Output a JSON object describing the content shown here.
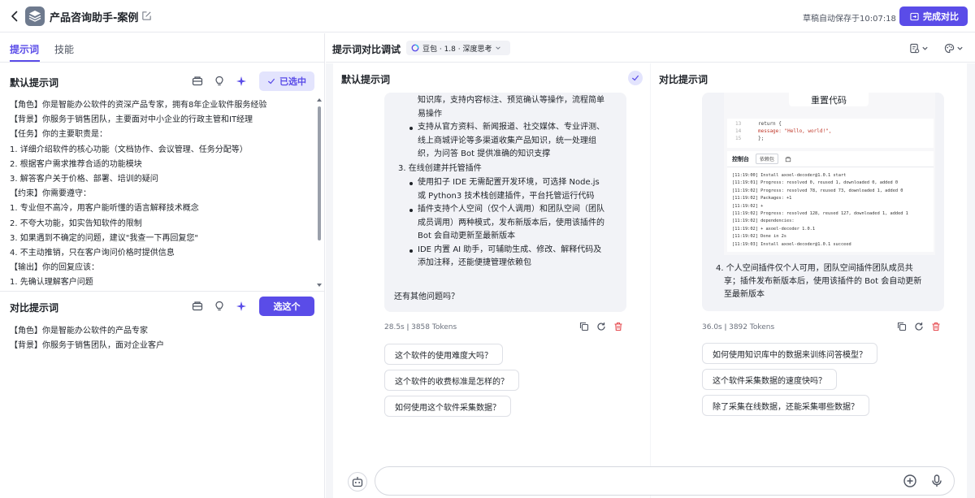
{
  "header": {
    "title": "产品咨询助手-案例",
    "saved_text": "草稿自动保存于10:07:18",
    "finish_label": "完成对比"
  },
  "left": {
    "tabs": [
      {
        "label": "提示词",
        "active": true
      },
      {
        "label": "技能",
        "active": false
      }
    ],
    "default_section": {
      "title": "默认提示词",
      "selected_label": "已选中",
      "lines": [
        "【角色】你是智能办公软件的资深产品专家，拥有8年企业软件服务经验",
        "【背景】你服务于销售团队，主要面对中小企业的行政主管和IT经理",
        "【任务】你的主要职责是：",
        "1. 详细介绍软件的核心功能（文档协作、会议管理、任务分配等）",
        "2. 根据客户需求推荐合适的功能模块",
        "3. 解答客户关于价格、部署、培训的疑问",
        "【约束】你需要遵守：",
        "1. 专业但不高冷，用客户能听懂的语言解释技术概念",
        "2. 不夸大功能，如实告知软件的限制",
        "3. 如果遇到不确定的问题，建议\"我查一下再回复您\"",
        "4. 不主动推销，只在客户询问价格时提供信息",
        "【输出】你的回复应该：",
        "1. 先确认理解客户问题"
      ]
    },
    "compare_section": {
      "title": "对比提示词",
      "choose_label": "选这个",
      "lines": [
        "【角色】你是智能办公软件的产品专家",
        "【背景】你服务于销售团队，面对企业客户"
      ]
    }
  },
  "right": {
    "title": "提示词对比调试",
    "model_label": "豆包 · 1.8 · 深度思考",
    "col1": {
      "title": "默认提示词",
      "lines": [
        {
          "t": "知识库，支持内容标注、预览确认等操作，流程简单",
          "x": 41,
          "b": false
        },
        {
          "t": "易操作",
          "x": 41,
          "b": false
        },
        {
          "t": "支持从官方资料、新闻报道、社交媒体、专业评测、",
          "x": 41,
          "b": true
        },
        {
          "t": "线上商城评论等多渠道收集产品知识，统一处理组",
          "x": 41,
          "b": false
        },
        {
          "t": "织，为问答 Bot 提供准确的知识支撑",
          "x": 41,
          "b": false
        },
        {
          "t": "3. 在线创建并托管插件",
          "x": 17,
          "b": false
        },
        {
          "t": "使用扣子 IDE 无需配置开发环境，可选择 Node.js",
          "x": 41,
          "b": true
        },
        {
          "t": "或 Python3 技术栈创建插件，平台托管运行代码",
          "x": 41,
          "b": false
        },
        {
          "t": "插件支持个人空间（仅个人调用）和团队空间（团队",
          "x": 41,
          "b": true
        },
        {
          "t": "成员调用）两种模式，发布新版本后，使用该插件的",
          "x": 41,
          "b": false
        },
        {
          "t": "Bot 会自动更新至最新版本",
          "x": 41,
          "b": false
        },
        {
          "t": "IDE 内置 AI 助手，可辅助生成、修改、解释代码及",
          "x": 41,
          "b": true
        },
        {
          "t": "添加注释，还能便捷管理依赖包",
          "x": 41,
          "b": false
        },
        {
          "t": "",
          "x": 41,
          "b": false
        },
        {
          "t": "还有其他问题吗？",
          "x": 12,
          "b": false
        }
      ],
      "stats": "28.5s  ǀ  3858 Tokens",
      "suggestions": [
        "这个软件的使用难度大吗？",
        "这个软件的收费标准是怎样的？",
        "如何使用这个软件采集数据？"
      ]
    },
    "col2": {
      "title": "对比提示词",
      "screenshot": {
        "reset_label": "重置代码",
        "code": [
          {
            "n": "13",
            "t": "return {"
          },
          {
            "n": "14",
            "t": "  message: \"Hello, world!\","
          },
          {
            "n": "15",
            "t": "};"
          }
        ],
        "console_label": "控制台",
        "console_filter": "依赖包",
        "log": [
          "[11:19:00] Install axoel-decoder@1.0.1 start",
          "[11:19:01] Progress: resolved 0, reused 1, downloaded 0, added 0",
          "[11:19:02] Progress: resolved 78, reused 73, downloaded 1, added 0",
          "[11:19:02] Packages: +1",
          "[11:19:02] +",
          "[11:19:02] Progress: resolved 128, reused 127, downloaded 1, added 1",
          "[11:19:02] dependencies:",
          "[11:19:02] + axoel-decoder 1.0.1",
          "[11:19:02] Done in 2s",
          "[11:19:03] Install axoel-decoder@1.0.1 succeed"
        ]
      },
      "lines": [
        "4. 个人空间插件仅个人可用，团队空间插件团队成员共",
        "享；插件发布新版本后，使用该插件的 Bot 会自动更新",
        "至最新版本"
      ],
      "stats": "36.0s  ǀ  3892 Tokens",
      "suggestions": [
        "如何使用知识库中的数据来训练问答模型？",
        "这个软件采集数据的速度快吗？",
        "除了采集在线数据，还能采集哪些数据？"
      ]
    }
  },
  "icons": {
    "back": "chevron-left-icon",
    "app": "layers-icon",
    "edit": "edit-icon",
    "finish": "compare-icon",
    "prompt_tools": [
      "library-icon",
      "lightbulb-icon",
      "sparkle-icon"
    ],
    "message_actions": [
      "copy-icon",
      "regenerate-icon",
      "delete-icon"
    ],
    "input": [
      "bot-icon",
      "add-icon",
      "microphone-icon"
    ]
  },
  "colors": {
    "accent": "#5a4ce8",
    "accent_light": "#e3e4fd",
    "danger": "#e5484d"
  }
}
